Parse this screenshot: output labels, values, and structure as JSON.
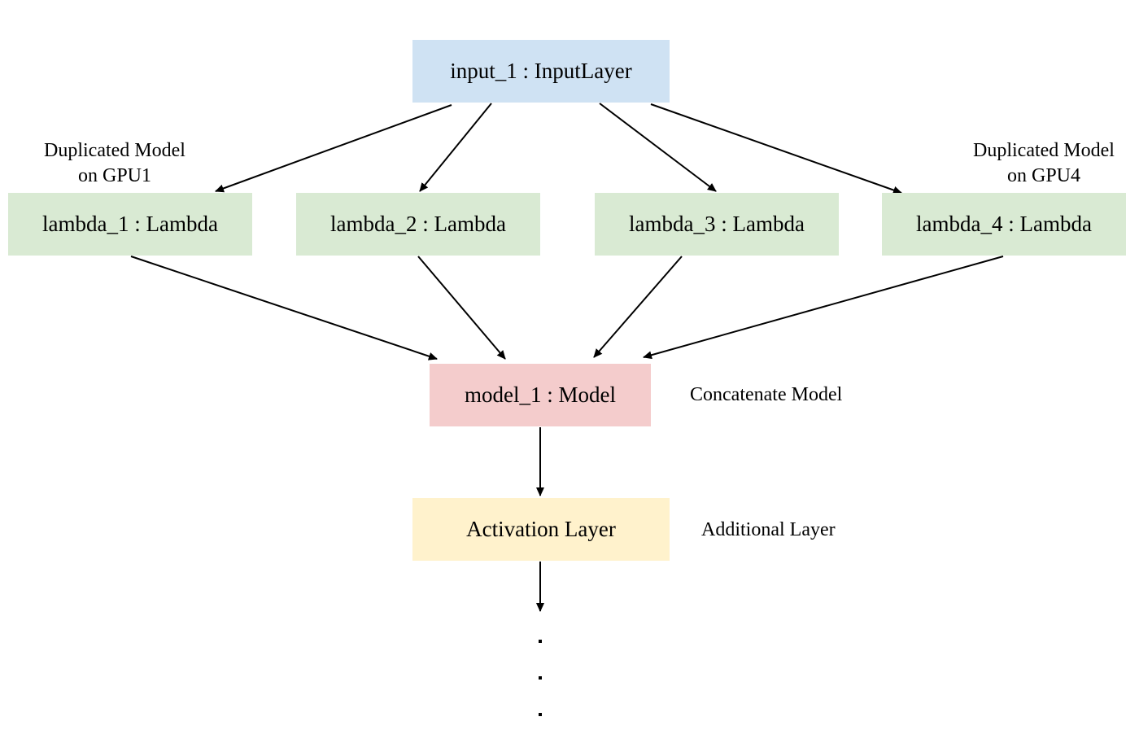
{
  "nodes": {
    "input": {
      "label": "input_1 : InputLayer",
      "color": "#cfe2f3"
    },
    "lambda_1": {
      "label": "lambda_1 : Lambda",
      "color": "#d9ead3"
    },
    "lambda_2": {
      "label": "lambda_2 : Lambda",
      "color": "#d9ead3"
    },
    "lambda_3": {
      "label": "lambda_3 : Lambda",
      "color": "#d9ead3"
    },
    "lambda_4": {
      "label": "lambda_4 : Lambda",
      "color": "#d9ead3"
    },
    "model_1": {
      "label": "model_1 : Model",
      "color": "#f4cccc"
    },
    "activation": {
      "label": "Activation Layer",
      "color": "#fff2cc"
    }
  },
  "annotations": {
    "gpu1_line1": "Duplicated Model",
    "gpu1_line2": "on GPU1",
    "gpu4_line1": "Duplicated Model",
    "gpu4_line2": "on GPU4",
    "concatenate": "Concatenate Model",
    "additional": "Additional Layer"
  },
  "edges": [
    {
      "from": "input",
      "to": "lambda_1"
    },
    {
      "from": "input",
      "to": "lambda_2"
    },
    {
      "from": "input",
      "to": "lambda_3"
    },
    {
      "from": "input",
      "to": "lambda_4"
    },
    {
      "from": "lambda_1",
      "to": "model_1"
    },
    {
      "from": "lambda_2",
      "to": "model_1"
    },
    {
      "from": "lambda_3",
      "to": "model_1"
    },
    {
      "from": "lambda_4",
      "to": "model_1"
    },
    {
      "from": "model_1",
      "to": "activation"
    },
    {
      "from": "activation",
      "to": "continuation"
    }
  ],
  "continuation": "..."
}
